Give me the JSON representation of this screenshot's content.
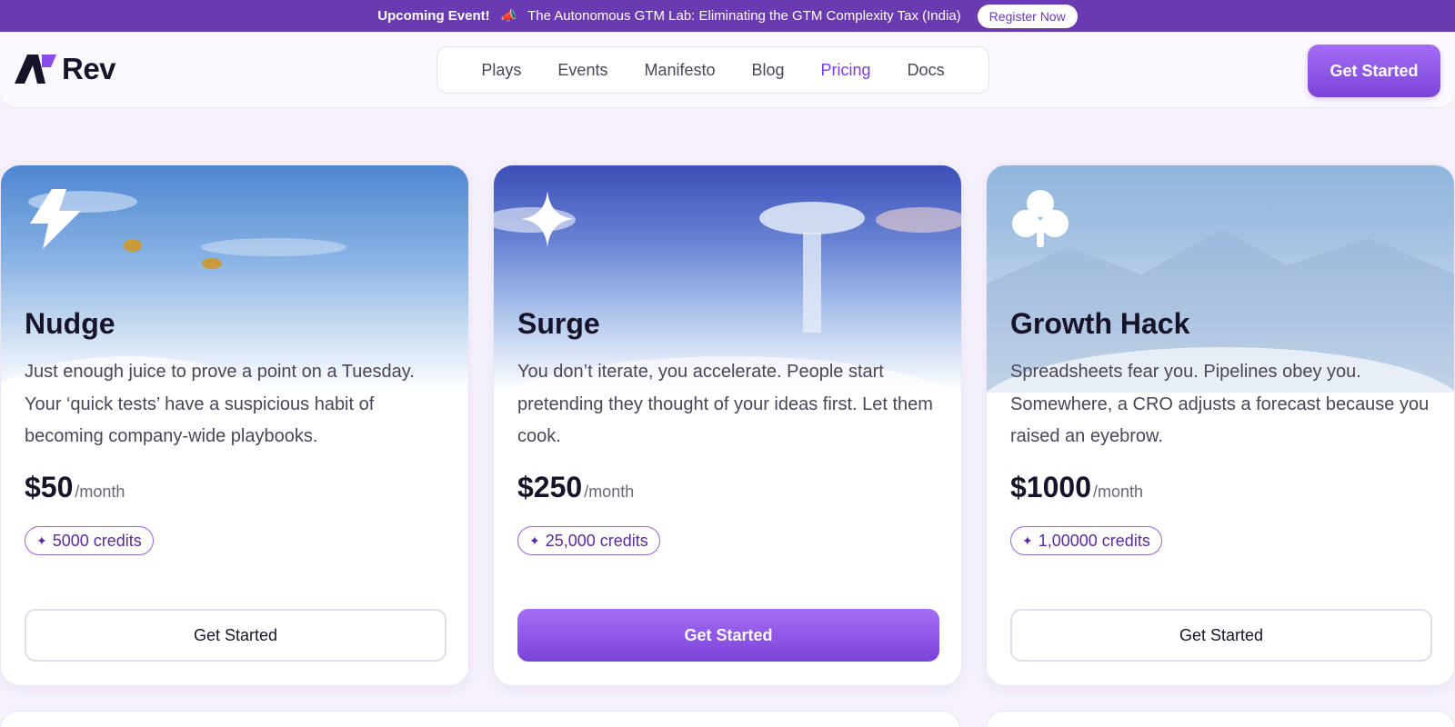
{
  "announcement": {
    "lead": "Upcoming Event!",
    "emoji": "📣",
    "text": "The Autonomous GTM Lab: Eliminating the GTM Complexity Tax (India)",
    "cta": "Register Now"
  },
  "header": {
    "logo_text": "Rev",
    "nav": [
      {
        "label": "Plays",
        "active": false
      },
      {
        "label": "Events",
        "active": false
      },
      {
        "label": "Manifesto",
        "active": false
      },
      {
        "label": "Blog",
        "active": false
      },
      {
        "label": "Pricing",
        "active": true
      },
      {
        "label": "Docs",
        "active": false
      }
    ],
    "cta": "Get Started"
  },
  "plans": [
    {
      "icon": "lightning-icon",
      "name": "Nudge",
      "description": "Just enough juice to prove a point on a Tuesday. Your ‘quick tests’ have a suspicious habit of becoming company-wide playbooks.",
      "price": "$50",
      "period": "/month",
      "credits": "5000 credits",
      "cta": "Get Started",
      "cta_style": "outline"
    },
    {
      "icon": "sparkle-icon",
      "name": "Surge",
      "description": "You don’t iterate, you accelerate. People start pretending they thought of your ideas first. Let them cook.",
      "price": "$250",
      "period": "/month",
      "credits": "25,000 credits",
      "cta": "Get Started",
      "cta_style": "filled"
    },
    {
      "icon": "club-icon",
      "name": "Growth Hack",
      "description": "Spreadsheets fear you. Pipelines obey you. Somewhere, a CRO adjusts a forecast because you raised an eyebrow.",
      "price": "$1000",
      "period": "/month",
      "credits": "1,00000 credits",
      "cta": "Get Started",
      "cta_style": "outline"
    }
  ],
  "colors": {
    "brand": "#7b44d8",
    "announce_bg": "#6a3bb0",
    "page_bg": "#f6f1fd",
    "active_nav": "#7a3cec"
  }
}
